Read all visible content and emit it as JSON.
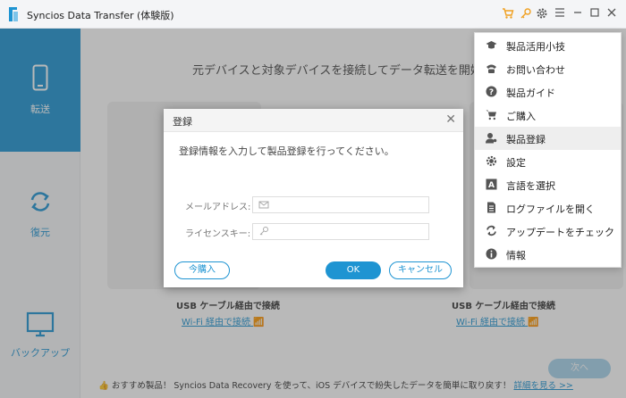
{
  "app": {
    "title": "Syncios Data Transfer (体験版)"
  },
  "sidebar": {
    "items": [
      {
        "label": "転送"
      },
      {
        "label": "復元"
      },
      {
        "label": "バックアップ"
      }
    ]
  },
  "main": {
    "headline": "元デバイスと対象デバイスを接続してデータ転送を開始してく",
    "left_device": {
      "usb": "USB ケーブル経由で接続",
      "wifi": "Wi-Fi 経由で接続"
    },
    "right_device": {
      "usb": "USB ケーブル経由で接続",
      "wifi": "Wi-Fi 経由で接続"
    },
    "next_button": "次へ",
    "banner": {
      "text": "おすすめ製品！ Syncios Data Recovery を使って、iOS デバイスで紛失したデータを簡単に取り戻す！",
      "link": "詳細を見る >>"
    }
  },
  "dialog": {
    "title": "登録",
    "description": "登録情報を入力して製品登録を行ってください。",
    "email_label": "メールアドレス:",
    "email_value": "",
    "license_label": "ライセンスキー:",
    "license_value": "",
    "buy_button": "今購入",
    "ok_button": "OK",
    "cancel_button": "キャンセル"
  },
  "menu": {
    "items": [
      {
        "label": "製品活用小技",
        "icon": "graduation-cap-icon"
      },
      {
        "label": "お問い合わせ",
        "icon": "phone-icon"
      },
      {
        "label": "製品ガイド",
        "icon": "help-icon"
      },
      {
        "label": "ご購入",
        "icon": "cart-icon"
      },
      {
        "label": "製品登録",
        "icon": "user-key-icon"
      },
      {
        "label": "設定",
        "icon": "gear-icon"
      },
      {
        "label": "言語を選択",
        "icon": "language-icon"
      },
      {
        "label": "ログファイルを開く",
        "icon": "document-icon"
      },
      {
        "label": "アップデートをチェック",
        "icon": "refresh-icon"
      },
      {
        "label": "情報",
        "icon": "info-icon"
      }
    ]
  },
  "colors": {
    "accent": "#1e94d2",
    "cart_icon": "#f0a020"
  }
}
